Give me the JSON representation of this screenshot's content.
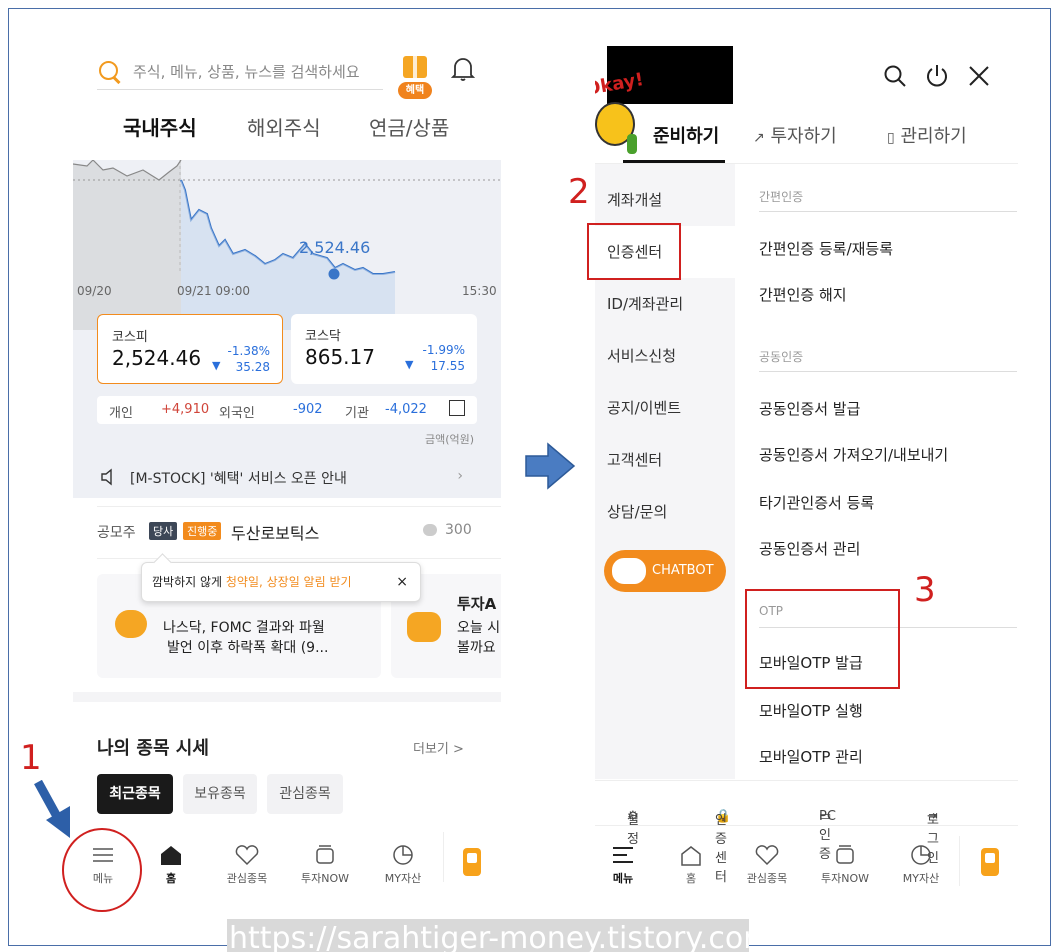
{
  "left": {
    "search_placeholder": "주식, 메뉴, 상품, 뉴스를 검색하세요",
    "benefit_badge": "혜택",
    "tabs": [
      "국내주식",
      "해외주식",
      "연금/상품"
    ],
    "chart": {
      "current_value": "2,524.46",
      "x_labels": [
        "09/20",
        "09/21 09:00",
        "15:30"
      ]
    },
    "indices": [
      {
        "name": "코스피",
        "value": "2,524.46",
        "change_pct": "-1.38%",
        "change": "35.28"
      },
      {
        "name": "코스닥",
        "value": "865.17",
        "change_pct": "-1.99%",
        "change": "17.55"
      }
    ],
    "trade": {
      "individual_label": "개인",
      "individual_value": "+4,910",
      "foreign_label": "외국인",
      "foreign_value": "-902",
      "inst_label": "기관",
      "inst_value": "-4,022"
    },
    "unit_note": "금액(억원)",
    "notice": "[M-STOCK] '혜택' 서비스 오픈 안내",
    "ipo": {
      "label": "공모주",
      "badge1": "당사",
      "badge2": "진행중",
      "name": "두산로보틱스",
      "count": "300"
    },
    "tooltip": {
      "prefix": "깜박하지 않게 ",
      "highlight": "청약일, 상장일 알림 받기",
      "close": "×"
    },
    "news": [
      {
        "line1": "나스닥, FOMC 결과와 파월",
        "line2": "발언 이후 하락폭 확대 (9..."
      },
      {
        "title": "투자A",
        "line1": "오늘 시",
        "line2": "볼까요"
      }
    ],
    "my_stocks_title": "나의 종목 시세",
    "more": "더보기 >",
    "chips": [
      "최근종목",
      "보유종목",
      "관심종목"
    ],
    "bottom_nav": [
      "메뉴",
      "홈",
      "관심종목",
      "투자NOW",
      "MY자산"
    ]
  },
  "right": {
    "tabs": [
      "준비하기",
      "투자하기",
      "관리하기"
    ],
    "left_menu": [
      "계좌개설",
      "인증센터",
      "ID/계좌관리",
      "서비스신청",
      "공지/이벤트",
      "고객센터",
      "상담/문의"
    ],
    "chatbot": "CHATBOT",
    "sections": [
      {
        "header": "간편인증",
        "items": [
          "간편인증 등록/재등록",
          "간편인증 해지"
        ]
      },
      {
        "header": "공동인증",
        "items": [
          "공동인증서 발급",
          "공동인증서 가져오기/내보내기",
          "타기관인증서 등록",
          "공동인증서 관리"
        ]
      },
      {
        "header": "OTP",
        "items": [
          "모바일OTP 발급",
          "모바일OTP 실행",
          "모바일OTP 관리"
        ]
      }
    ],
    "utility": [
      "설정",
      "인증센터",
      "PC 인증",
      "로그인"
    ],
    "bottom_nav": [
      "메뉴",
      "홈",
      "관심종목",
      "투자NOW",
      "MY자산"
    ]
  },
  "annotations": {
    "step1": "1",
    "step2": "2",
    "step3": "3"
  },
  "watermark": "https://sarahtiger-money.tistory.com",
  "colors": {
    "orange": "#f28b1d",
    "blue": "#2a6fdb",
    "red": "#d0201f",
    "annotation_red": "#d0201f"
  }
}
